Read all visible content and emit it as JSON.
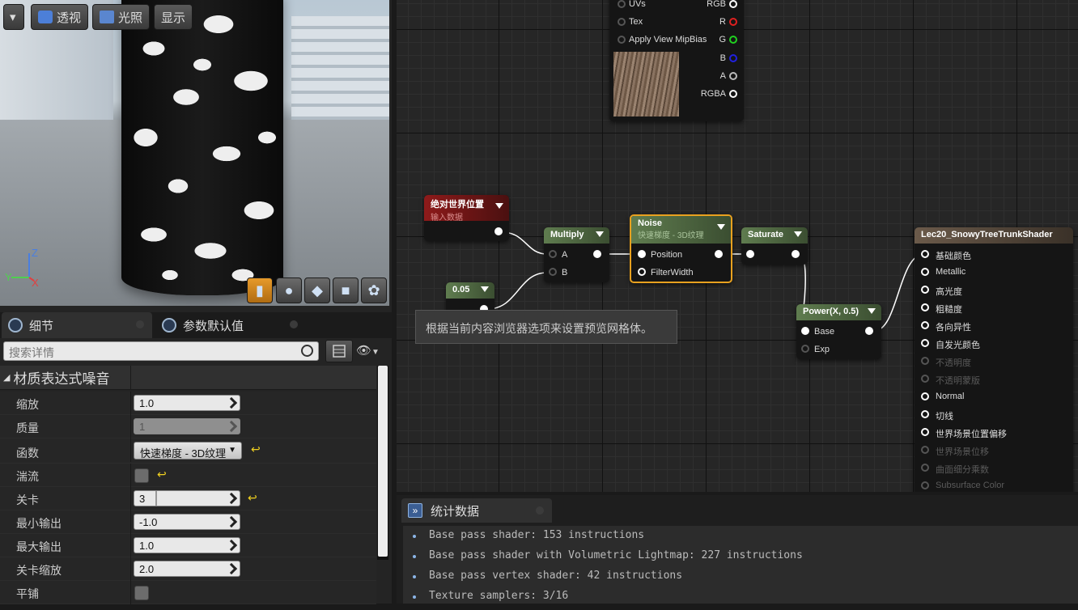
{
  "viewport": {
    "menu_label": "▾",
    "perspective": "透视",
    "lighting": "光照",
    "show": "显示",
    "axis_z": "Z",
    "axis_y": "Y",
    "axis_x": "X"
  },
  "tabs": {
    "details": "细节",
    "defaults": "参数默认值"
  },
  "search": {
    "placeholder": "搜索详情"
  },
  "category": "材质表达式噪音",
  "props": [
    {
      "label": "缩放",
      "value": "1.0"
    },
    {
      "label": "质量",
      "value": "1"
    },
    {
      "label": "函数",
      "value": "快速梯度 - 3D纹理"
    },
    {
      "label": "湍流"
    },
    {
      "label": "关卡",
      "value": "3"
    },
    {
      "label": "最小输出",
      "value": "-1.0"
    },
    {
      "label": "最大输出",
      "value": "1.0"
    },
    {
      "label": "关卡缩放",
      "value": "2.0"
    },
    {
      "label": "平铺"
    }
  ],
  "graph": {
    "tex": {
      "uvs": "UVs",
      "tex": "Tex",
      "mip": "Apply View MipBias",
      "rgb": "RGB",
      "r": "R",
      "g": "G",
      "b": "B",
      "a": "A",
      "rgba": "RGBA"
    },
    "world": {
      "title": "绝对世界位置",
      "sub": "输入数据"
    },
    "const": {
      "title": "0.05"
    },
    "multiply": {
      "title": "Multiply",
      "a": "A",
      "b": "B"
    },
    "noise": {
      "title": "Noise",
      "sub": "快速梯度 - 3D纹理",
      "position": "Position",
      "filter": "FilterWidth"
    },
    "saturate": {
      "title": "Saturate"
    },
    "power": {
      "title": "Power(X, 0.5)",
      "base": "Base",
      "exp": "Exp"
    },
    "material": {
      "title": "Lec20_SnowyTreeTrunkShader",
      "pins": [
        "基础颜色",
        "Metallic",
        "高光度",
        "粗糙度",
        "各向异性",
        "自发光颜色",
        "不透明度",
        "不透明蒙版",
        "Normal",
        "切线",
        "世界场景位置偏移",
        "世界场景位移",
        "曲面细分乘数",
        "Subsurface Color"
      ]
    }
  },
  "tooltip": "根据当前内容浏览器选项来设置预览网格体。",
  "stats": {
    "title": "统计数据",
    "lines": [
      "Base pass shader: 153 instructions",
      "Base pass shader with Volumetric Lightmap: 227 instructions",
      "Base pass vertex shader: 42 instructions",
      "Texture samplers: 3/16"
    ]
  },
  "colors": {
    "accent": "#e8a11f",
    "node_green": "#5f7c4f",
    "world_red": "#8e1a1a",
    "material_brown": "#6b5a4a"
  }
}
